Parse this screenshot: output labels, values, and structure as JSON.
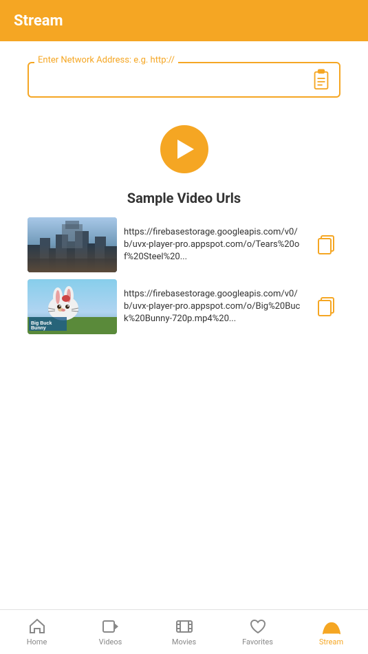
{
  "header": {
    "title": "Stream"
  },
  "network_input": {
    "label": "Enter Network Address: e.g. http://",
    "placeholder": "",
    "value": ""
  },
  "play_button": {
    "label": "Play"
  },
  "section": {
    "title": "Sample Video Urls"
  },
  "videos": [
    {
      "url": "https://firebasestorage.googleapis.com/v0/b/uvx-player-pro.appspot.com/o/Tears%20of%20Steel%20...",
      "thumb_alt": "Tears of Steel"
    },
    {
      "url": "https://firebasestorage.googleapis.com/v0/b/uvx-player-pro.appspot.com/o/Big%20Buck%20Bunny-720p.mp4%20...",
      "thumb_alt": "Big Buck Bunny"
    }
  ],
  "bottom_nav": {
    "items": [
      {
        "id": "home",
        "label": "Home",
        "active": false
      },
      {
        "id": "videos",
        "label": "Videos",
        "active": false
      },
      {
        "id": "movies",
        "label": "Movies",
        "active": false
      },
      {
        "id": "favorites",
        "label": "Favorites",
        "active": false
      },
      {
        "id": "stream",
        "label": "Stream",
        "active": true
      }
    ]
  }
}
